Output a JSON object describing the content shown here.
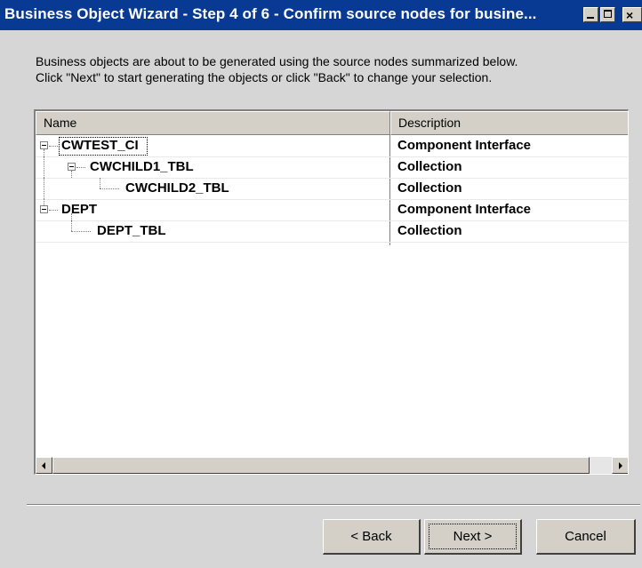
{
  "window": {
    "title": "Business Object Wizard - Step 4 of 6 - Confirm source nodes for busine..."
  },
  "intro": {
    "line1": "Business objects are about to be generated using the source nodes summarized below.",
    "line2": "Click \"Next\" to start generating the objects or click \"Back\" to change your selection."
  },
  "table": {
    "headers": {
      "name": "Name",
      "description": "Description"
    },
    "rows": [
      {
        "name": "CWTEST_CI",
        "description": "Component Interface"
      },
      {
        "name": "CWCHILD1_TBL",
        "description": "Collection"
      },
      {
        "name": "CWCHILD2_TBL",
        "description": "Collection"
      },
      {
        "name": "DEPT",
        "description": "Component Interface"
      },
      {
        "name": "DEPT_TBL",
        "description": "Collection"
      }
    ]
  },
  "buttons": {
    "back": "< Back",
    "next": "Next >",
    "cancel": "Cancel"
  }
}
